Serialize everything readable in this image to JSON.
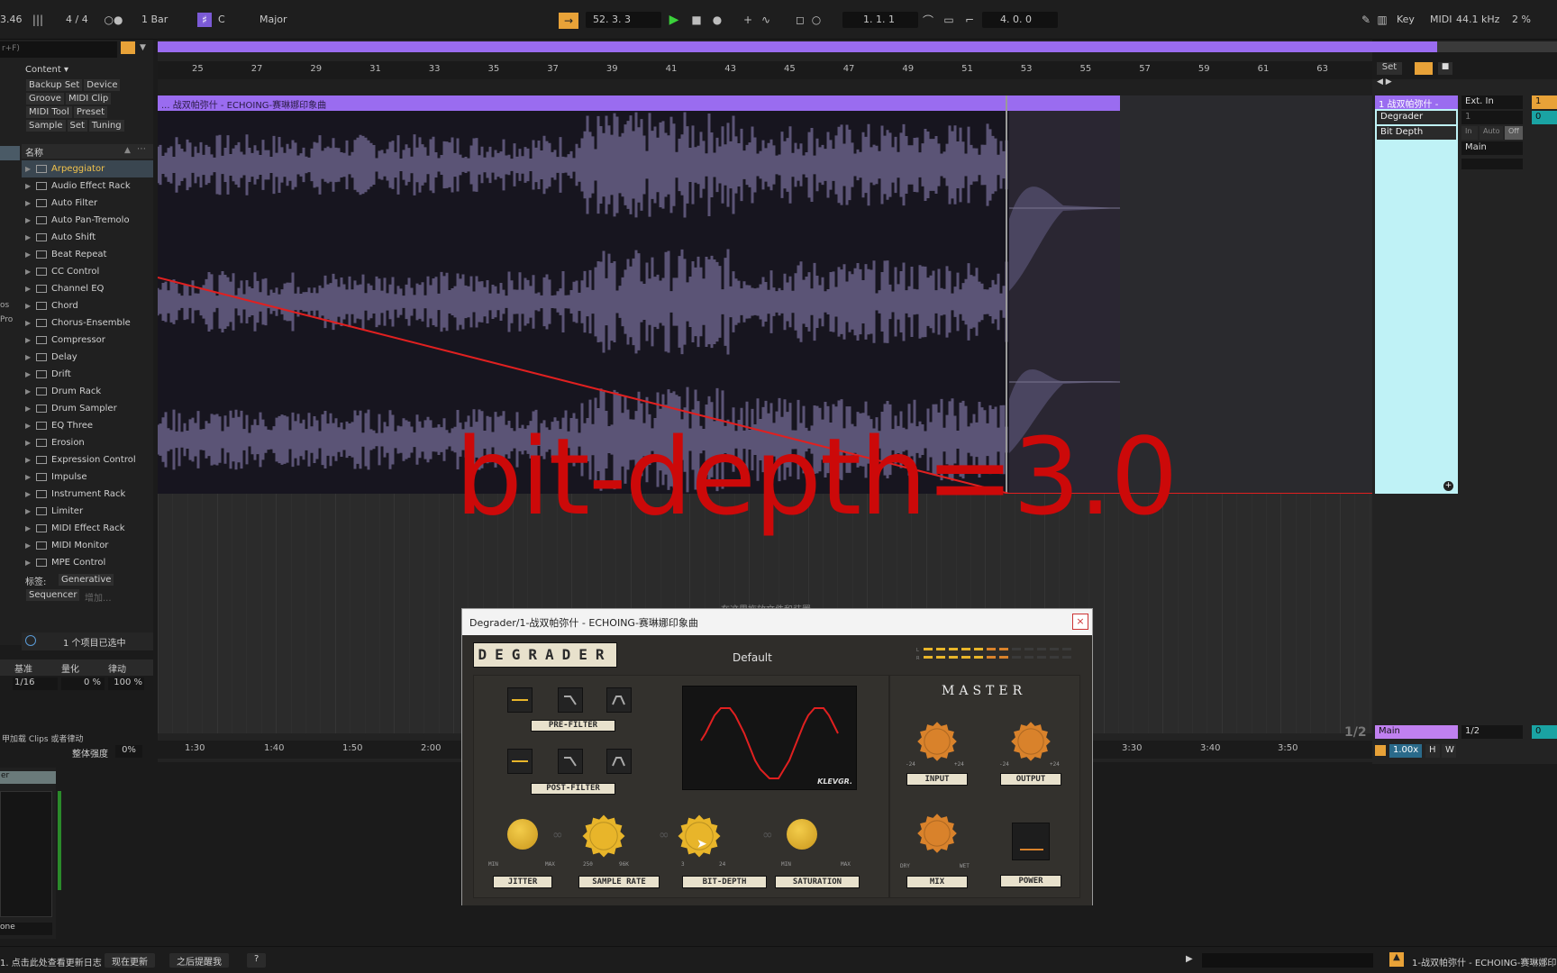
{
  "topbar": {
    "tempo_fragment": "3.46",
    "time_signature": "4 / 4",
    "quantize": "1 Bar",
    "key_root": "C",
    "scale": "Major",
    "position": "52.  3.  3",
    "loop_start": "1.   1.   1",
    "loop_length": "4.   0.   0",
    "key_label": "Key",
    "midi_label": "MIDI",
    "sample_rate": "44.1 kHz",
    "cpu": "2 %"
  },
  "browser": {
    "search_hint": "r+F)",
    "content_label": "Content ▾",
    "tags": [
      "Backup Set",
      "Device",
      "Groove",
      "MIDI Clip",
      "MIDI Tool",
      "Preset",
      "Sample",
      "Set",
      "Tuning"
    ],
    "name_header": "名称",
    "items": [
      "Arpeggiator",
      "Audio Effect Rack",
      "Auto Filter",
      "Auto Pan-Tremolo",
      "Auto Shift",
      "Beat Repeat",
      "CC Control",
      "Channel EQ",
      "Chord",
      "Chorus-Ensemble",
      "Compressor",
      "Delay",
      "Drift",
      "Drum Rack",
      "Drum Sampler",
      "EQ Three",
      "Erosion",
      "Expression Control",
      "Impulse",
      "Instrument Rack",
      "Limiter",
      "MIDI Effect Rack",
      "MIDI Monitor",
      "MPE Control"
    ],
    "tags_label": "标签:",
    "tag_generative": "Generative",
    "tag_sequencer": "Sequencer",
    "tag_add": "增加...",
    "selection_status": "1 个项目已选中",
    "groove_headers": [
      "基准",
      "量化",
      "律动"
    ],
    "groove_values": [
      "1/16",
      "0 %",
      "100 %"
    ],
    "groove_hint": "甲加载 Clips 或者律动",
    "global_amount_label": "整体强度",
    "global_amount_value": "0%",
    "side_fragment_1": "os",
    "side_fragment_2": "Pro",
    "mini_label": "er",
    "mini_select": "one"
  },
  "arrangement": {
    "bar_ticks": [
      "25",
      "27",
      "29",
      "31",
      "33",
      "35",
      "37",
      "39",
      "41",
      "43",
      "45",
      "47",
      "49",
      "51",
      "53",
      "55",
      "57",
      "59",
      "61",
      "63"
    ],
    "clip_name": "... 战双帕弥什 - ECHOING-赛琳娜印象曲",
    "time_ticks": [
      "1:30",
      "1:40",
      "1:50",
      "2:00",
      "3:30",
      "3:40",
      "3:50"
    ],
    "hint_text": "在这里拖放文件和装置",
    "page_indicator": "1/2",
    "set_label": "Set"
  },
  "track": {
    "name": "1 战双帕弥什 -",
    "device_chip": "Degrader",
    "param_chip": "Bit Depth",
    "input": "Ext. In",
    "input_channel": "1",
    "monitor_in": "In",
    "monitor_auto": "Auto",
    "monitor_off": "Off",
    "output": "Main",
    "main_chip": "Main",
    "output_ratio": "1/2",
    "track_number": "1",
    "zero_value": "0",
    "zoom_value": "1.00x",
    "h_label": "H",
    "w_label": "W"
  },
  "overlay": {
    "big_text": "bit-depth=3.0"
  },
  "plugin": {
    "title": "Degrader/1-战双帕弥什 - ECHOING-赛琳娜印象曲",
    "logo": "DEGRADER",
    "preset": "Default",
    "master_label": "MASTER",
    "pre_filter": "PRE-FILTER",
    "post_filter": "POST-FILTER",
    "brand": "KLEVGR.",
    "knobs": [
      "JITTER",
      "SAMPLE RATE",
      "BIT-DEPTH",
      "SATURATION"
    ],
    "master_knobs": [
      "INPUT",
      "OUTPUT",
      "MIX",
      "POWER"
    ],
    "jitter_min": "MIN",
    "jitter_max": "MAX",
    "sr_min": "250",
    "sr_max": "96K",
    "bd_min": "3",
    "bd_max": "24",
    "sat_min": "MIN",
    "sat_max": "MAX",
    "io_min": "-24",
    "io_max": "+24",
    "mix_min": "DRY",
    "mix_max": "WET",
    "meter_l": "L",
    "meter_r": "R"
  },
  "status": {
    "changelog": "1. 点击此处查看更新日志",
    "update_now": "现在更新",
    "remind_later": "之后提醒我",
    "help": "?",
    "current_clip": "1-战双帕弥什 - ECHOING-赛琳娜印象曲"
  },
  "colors": {
    "accent": "#9a6cf0",
    "clip_head": "#9a6cf0",
    "track_cyan": "#bff2f6",
    "overlay_red": "#cc0909",
    "knob_yellow": "#e8b52a",
    "knob_orange": "#d9822b",
    "play_green": "#3bd13b"
  }
}
